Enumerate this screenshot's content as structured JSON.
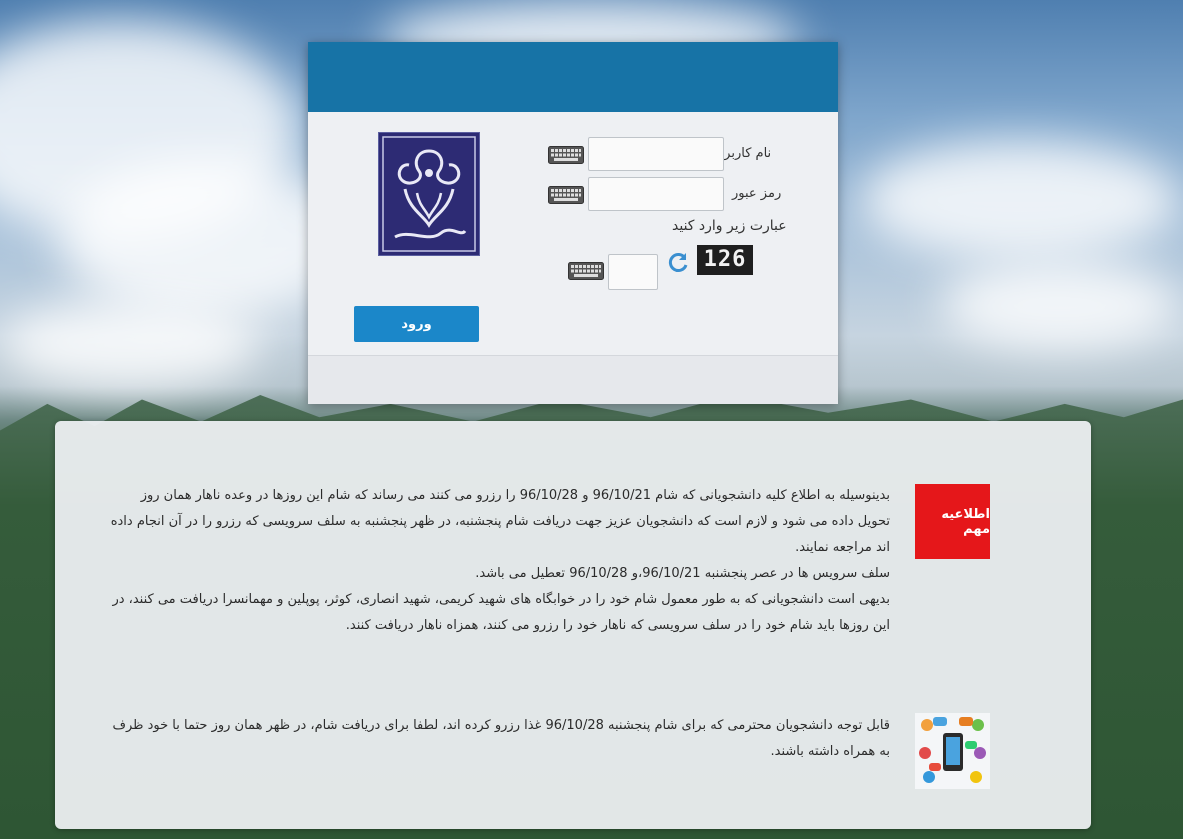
{
  "login": {
    "username_label": "نام کاربری",
    "password_label": "رمز عبور",
    "captcha_prompt": "عبارت زیر وارد کنید",
    "captcha_value": "126",
    "username_value": "",
    "password_value": "",
    "captcha_input_value": "",
    "submit_label": "ورود",
    "logo_alt": "دانشگاه گیلان"
  },
  "notices": {
    "badge_label": "اطلاعیه مهم",
    "announcement_lines": [
      "بدینوسیله به اطلاع کلیه دانشجویانی که شام 96/10/21  و 96/10/28 را رزرو می کنند می رساند که شام این روزها در وعده ناهار همان روز تحویل داده می شود و لازم است که دانشجویان عزیز جهت دریافت شام پنجشنبه، در ظهر پنجشنبه به سلف سرویسی که رزرو را در آن انجام داده اند مراجعه نمایند.",
      "سلف سرویس ها در عصر پنجشنبه 96/10/21،و 96/10/28  تعطیل می باشد.",
      "بدیهی است دانشجویانی که به طور معمول شام خود را در خوابگاه های شهید کریمی، شهید انصاری، کوثر، پوپلین و مهمانسرا دریافت می کنند، در این روزها باید شام خود را در سلف سرویسی که ناهار خود را رزرو می کنند، همزاه ناهار دریافت کنند."
    ],
    "second_notice": "قابل توجه دانشجویان محترمی که برای شام پنجشنبه 96/10/28 غذا رزرو کرده اند، لطفا برای دریافت شام، در ظهر همان روز حتما با خود ظرف به همراه داشته باشند."
  },
  "icons": {
    "keyboard": "keyboard-icon",
    "refresh": "refresh-icon",
    "social": "social-network-icon"
  },
  "colors": {
    "header": "#1773a6",
    "button": "#1b87c9",
    "badge": "#e5171a"
  }
}
